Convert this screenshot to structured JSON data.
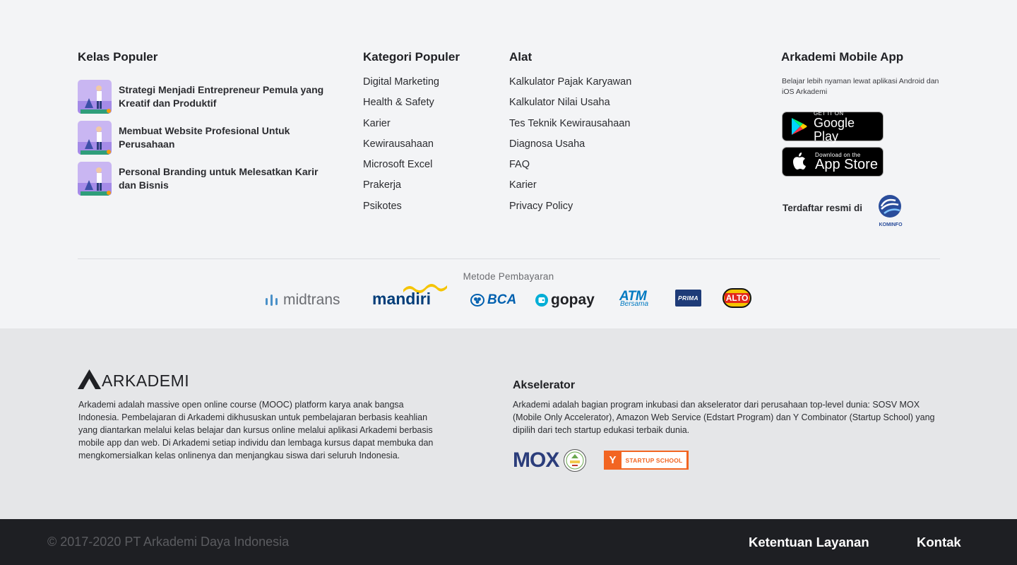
{
  "popular_classes": {
    "title": "Kelas Populer",
    "items": [
      {
        "title": "Strategi Menjadi Entrepreneur Pemula yang Kreatif dan Produktif"
      },
      {
        "title": "Membuat Website Profesional Untuk Perusahaan"
      },
      {
        "title": "Personal Branding untuk Melesatkan Karir dan Bisnis"
      }
    ]
  },
  "popular_categories": {
    "title": "Kategori Populer",
    "items": [
      "Digital Marketing",
      "Health & Safety",
      "Karier",
      "Kewirausahaan",
      "Microsoft Excel",
      "Prakerja",
      "Psikotes"
    ]
  },
  "tools": {
    "title": "Alat",
    "items": [
      "Kalkulator Pajak Karyawan",
      "Kalkulator Nilai Usaha",
      "Tes Teknik Kewirausahaan",
      "Diagnosa Usaha",
      "FAQ",
      "Karier",
      "Privacy Policy"
    ]
  },
  "mobile_app": {
    "title": "Arkademi Mobile App",
    "description": "Belajar lebih nyaman lewat aplikasi Android dan iOS Arkademi",
    "google_play": {
      "small": "GET IT ON",
      "big": "Google Play"
    },
    "app_store": {
      "small": "Download on the",
      "big": "App Store"
    },
    "registered_label": "Terdaftar resmi di",
    "kominfo_label": "KOMINFO"
  },
  "payment": {
    "title": "Metode Pembayaran",
    "methods": {
      "midtrans": "midtrans",
      "mandiri": "mandiri",
      "bca": "BCA",
      "gopay": "gopay",
      "atm_bersama": "ATM",
      "atm_bersama_sub": "Bersama",
      "prima": "PRIMA",
      "alto": "ALTO"
    }
  },
  "about": {
    "logo_text": "ARKADEMI",
    "description": "Arkademi adalah massive open online course (MOOC) platform karya anak bangsa Indonesia. Pembelajaran di Arkademi dikhususkan untuk pembelajaran berbasis keahlian yang diantarkan melalui kelas belajar dan kursus online melalui aplikasi Arkademi berbasis mobile app dan web. Di Arkademi setiap individu dan lembaga kursus dapat membuka dan mengkomersialkan kelas onlinenya dan menjangkau siswa dari seluruh Indonesia."
  },
  "accelerator": {
    "title": "Akselerator",
    "description": "Arkademi adalah bagian program inkubasi dan akselerator dari perusahaan top-level dunia: SOSV MOX (Mobile Only Accelerator), Amazon Web Service (Edstart Program) dan Y Combinator (Startup School) yang dipilih dari tech startup edukasi terbaik dunia.",
    "mox_label": "MOX",
    "yc_letter": "Y",
    "yc_label": "STARTUP SCHOOL"
  },
  "bottom_bar": {
    "copyright": "© 2017-2020 PT Arkademi Daya Indonesia",
    "terms": "Ketentuan Layanan",
    "contact": "Kontak"
  },
  "colors": {
    "top_bg": "#f3f4f6",
    "mid_bg": "#e5e6e8",
    "bottom_bg": "#1e1f23",
    "text": "#1f2024",
    "mandiri_blue": "#003d79",
    "mandiri_yellow": "#f5c400",
    "bca_blue": "#0060af",
    "gopay_blue": "#00aed6",
    "yc_orange": "#f26522",
    "mox_blue": "#2b3d7b"
  }
}
